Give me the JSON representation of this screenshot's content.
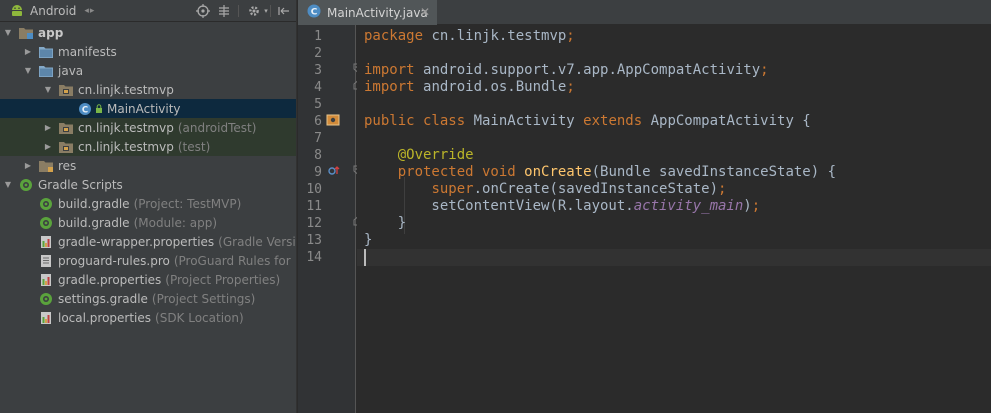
{
  "project_panel": {
    "view_label": "Android",
    "view_arrows": "◂▸",
    "tree": [
      {
        "id": "app",
        "label": "app",
        "depth": 0,
        "expanded": true,
        "icon": "module-folder-icon",
        "bold": true
      },
      {
        "id": "manifests",
        "label": "manifests",
        "depth": 1,
        "expanded": false,
        "icon": "folder-icon"
      },
      {
        "id": "java",
        "label": "java",
        "depth": 1,
        "expanded": true,
        "icon": "folder-icon"
      },
      {
        "id": "pkg-main",
        "label": "cn.linjk.testmvp",
        "depth": 2,
        "expanded": true,
        "icon": "package-icon"
      },
      {
        "id": "main-activity",
        "label": "MainActivity",
        "depth": 3,
        "icon": "class-icon",
        "selected": true
      },
      {
        "id": "pkg-androidtest",
        "label": "cn.linjk.testmvp",
        "hint": "(androidTest)",
        "depth": 2,
        "expanded": false,
        "icon": "package-icon",
        "test": true
      },
      {
        "id": "pkg-test",
        "label": "cn.linjk.testmvp",
        "hint": "(test)",
        "depth": 2,
        "expanded": false,
        "icon": "package-icon",
        "test": true
      },
      {
        "id": "res",
        "label": "res",
        "depth": 1,
        "expanded": false,
        "icon": "res-folder-icon"
      },
      {
        "id": "gradle-scripts",
        "label": "Gradle Scripts",
        "depth": 0,
        "expanded": true,
        "icon": "gradle-icon"
      },
      {
        "id": "build-gradle-project",
        "label": "build.gradle",
        "hint": "(Project: TestMVP)",
        "depth": 1,
        "icon": "gradle-file-icon"
      },
      {
        "id": "build-gradle-app",
        "label": "build.gradle",
        "hint": "(Module: app)",
        "depth": 1,
        "icon": "gradle-file-icon"
      },
      {
        "id": "gradle-wrapper",
        "label": "gradle-wrapper.properties",
        "hint": "(Gradle Versi",
        "depth": 1,
        "icon": "properties-file-icon"
      },
      {
        "id": "proguard",
        "label": "proguard-rules.pro",
        "hint": "(ProGuard Rules for",
        "depth": 1,
        "icon": "text-file-icon"
      },
      {
        "id": "gradle-properties",
        "label": "gradle.properties",
        "hint": "(Project Properties)",
        "depth": 1,
        "icon": "properties-file-icon"
      },
      {
        "id": "settings-gradle",
        "label": "settings.gradle",
        "hint": "(Project Settings)",
        "depth": 1,
        "icon": "gradle-file-icon"
      },
      {
        "id": "local-properties",
        "label": "local.properties",
        "hint": "(SDK Location)",
        "depth": 1,
        "icon": "properties-file-icon"
      }
    ]
  },
  "editor": {
    "tab_label": "MainActivity.java",
    "line_numbers": [
      "1",
      "2",
      "3",
      "4",
      "5",
      "6",
      "7",
      "8",
      "9",
      "10",
      "11",
      "12",
      "13",
      "14"
    ],
    "lines": [
      [
        {
          "t": "package ",
          "c": "kw"
        },
        {
          "t": "cn.linjk.testmvp",
          "c": ""
        },
        {
          "t": ";",
          "c": "kw"
        }
      ],
      [],
      [
        {
          "t": "import ",
          "c": "kw"
        },
        {
          "t": "android.support.v7.app.AppCompatActivity",
          "c": ""
        },
        {
          "t": ";",
          "c": "kw"
        }
      ],
      [
        {
          "t": "import ",
          "c": "kw"
        },
        {
          "t": "android.os.Bundle",
          "c": ""
        },
        {
          "t": ";",
          "c": "kw"
        }
      ],
      [],
      [
        {
          "t": "public class ",
          "c": "kw"
        },
        {
          "t": "MainActivity ",
          "c": ""
        },
        {
          "t": "extends ",
          "c": "kw"
        },
        {
          "t": "AppCompatActivity {",
          "c": ""
        }
      ],
      [],
      [
        {
          "t": "    ",
          "c": ""
        },
        {
          "t": "@Override",
          "c": "an"
        }
      ],
      [
        {
          "t": "    ",
          "c": ""
        },
        {
          "t": "protected void ",
          "c": "kw"
        },
        {
          "t": "onCreate",
          "c": "fn"
        },
        {
          "t": "(Bundle savedInstanceState) {",
          "c": ""
        }
      ],
      [
        {
          "t": "        ",
          "c": ""
        },
        {
          "t": "super",
          "c": "kw"
        },
        {
          "t": ".onCreate(savedInstanceState)",
          "c": ""
        },
        {
          "t": ";",
          "c": "kw"
        }
      ],
      [
        {
          "t": "        setContentView(R.layout.",
          "c": ""
        },
        {
          "t": "activity_main",
          "c": "it"
        },
        {
          "t": ")",
          "c": ""
        },
        {
          "t": ";",
          "c": "kw"
        }
      ],
      [
        {
          "t": "    }",
          "c": ""
        }
      ],
      [
        {
          "t": "}",
          "c": ""
        }
      ],
      []
    ],
    "caret_line": 14
  },
  "colors": {
    "keyword": "#cc7832",
    "method": "#ffc66d",
    "annotation": "#bbb529",
    "field": "#9876aa",
    "text": "#a9b7c6"
  }
}
